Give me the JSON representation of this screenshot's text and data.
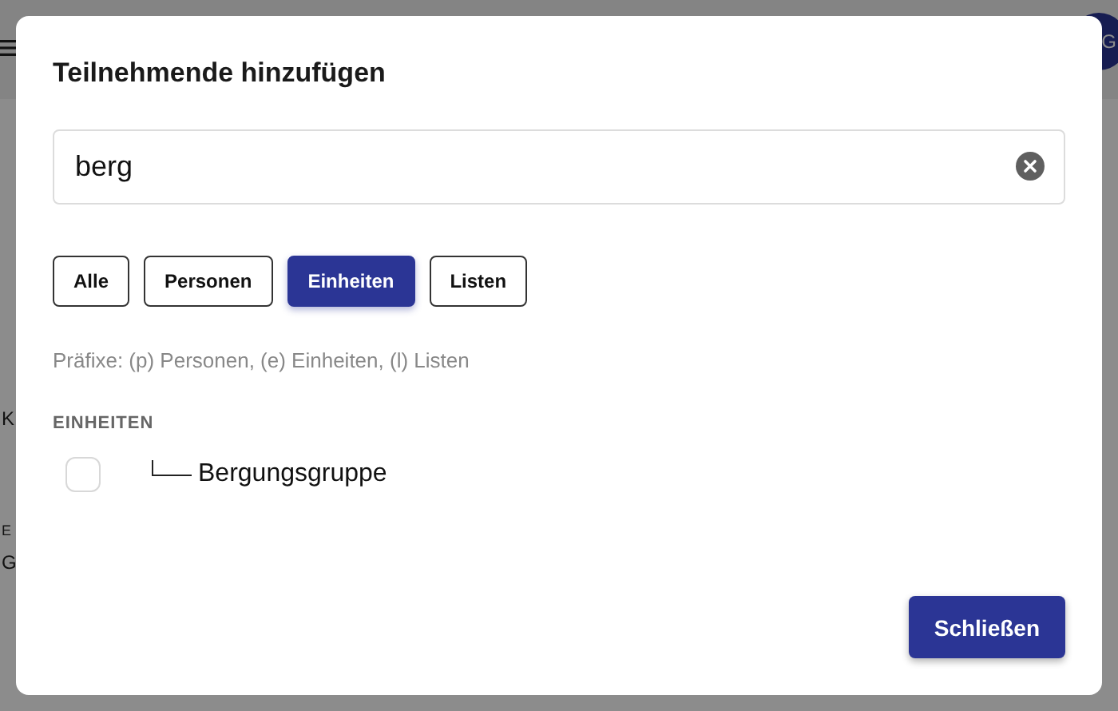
{
  "background": {
    "avatar_initial": "G",
    "fragments": [
      "K",
      "E",
      "G"
    ]
  },
  "dialog": {
    "title": "Teilnehmende hinzufügen",
    "search": {
      "value": "berg"
    },
    "filters": [
      {
        "label": "Alle",
        "selected": false
      },
      {
        "label": "Personen",
        "selected": false
      },
      {
        "label": "Einheiten",
        "selected": true
      },
      {
        "label": "Listen",
        "selected": false
      }
    ],
    "hint": "Präfixe: (p) Personen, (e) Einheiten, (l) Listen",
    "sections": [
      {
        "heading": "EINHEITEN",
        "items": [
          {
            "label": "Bergungsgruppe",
            "checked": false
          }
        ]
      }
    ],
    "buttons": [
      {
        "label": "Schließen"
      }
    ]
  }
}
